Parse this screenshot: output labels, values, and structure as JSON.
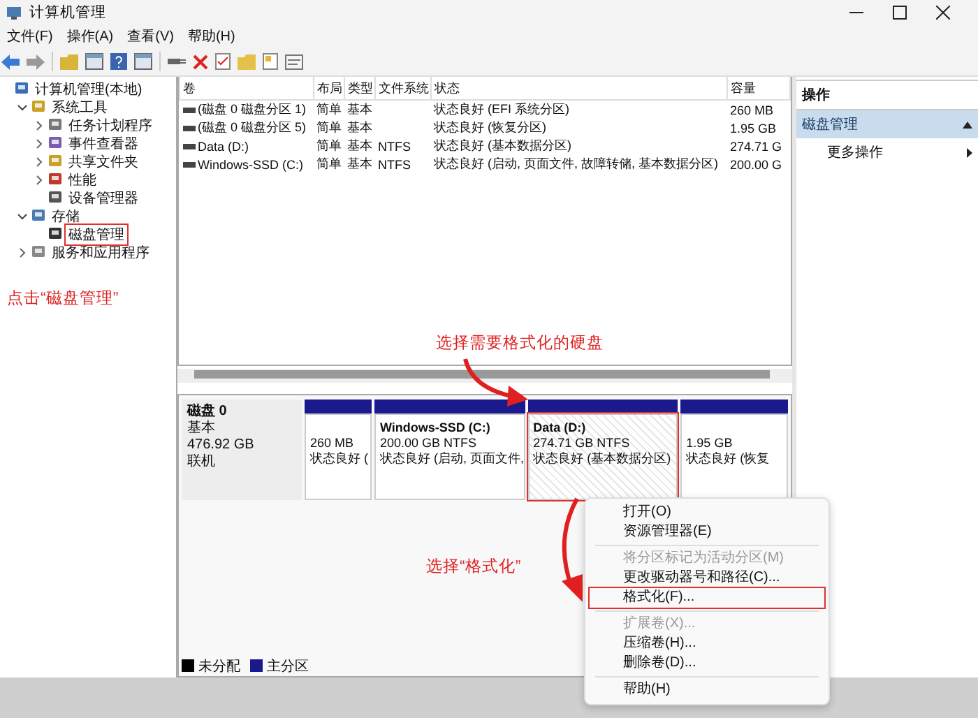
{
  "window": {
    "title": "计算机管理"
  },
  "menu_bar": [
    "文件(F)",
    "操作(A)",
    "查看(V)",
    "帮助(H)"
  ],
  "tree": [
    {
      "label": "计算机管理(本地)",
      "children": [
        {
          "label": "系统工具",
          "expanded": true,
          "children": [
            {
              "label": "任务计划程序",
              "expanded": false
            },
            {
              "label": "事件查看器",
              "expanded": false
            },
            {
              "label": "共享文件夹",
              "expanded": false
            },
            {
              "label": "性能",
              "expanded": false
            },
            {
              "label": "设备管理器"
            }
          ]
        },
        {
          "label": "存储",
          "expanded": true,
          "children": [
            {
              "label": "磁盘管理",
              "callout": true
            }
          ]
        },
        {
          "label": "服务和应用程序",
          "expanded": false
        }
      ]
    }
  ],
  "volume_table": {
    "columns": [
      "卷",
      "布局",
      "类型",
      "文件系统",
      "状态",
      "容量"
    ],
    "rows": [
      {
        "volume": "(磁盘 0 磁盘分区 1)",
        "layout": "简单",
        "type": "基本",
        "status": "状态良好 (EFI 系统分区)",
        "capacity": "260 MB"
      },
      {
        "volume": "(磁盘 0 磁盘分区 5)",
        "layout": "简单",
        "type": "基本",
        "status": "状态良好 (恢复分区)",
        "capacity": "1.95 GB"
      },
      {
        "volume": "Data (D:)",
        "layout": "简单",
        "type": "基本",
        "filesystem": "NTFS",
        "status": "状态良好 (基本数据分区)",
        "capacity": "274.71 G"
      },
      {
        "volume": "Windows-SSD (C:)",
        "layout": "简单",
        "type": "基本",
        "filesystem": "NTFS",
        "status": "状态良好 (启动, 页面文件, 故障转储, 基本数据分区)",
        "capacity": "200.00 G"
      }
    ]
  },
  "disk": {
    "name": "磁盘 0",
    "type": "基本",
    "size": "476.92 GB",
    "status": "联机",
    "partitions": [
      {
        "size": "260 MB",
        "status": "状态良好 (",
        "selected": false
      },
      {
        "title": "Windows-SSD  (C:)",
        "size": "200.00 GB NTFS",
        "status": "状态良好 (启动, 页面文件,",
        "selected": false
      },
      {
        "title": "Data  (D:)",
        "size": "274.71 GB NTFS",
        "status": "状态良好 (基本数据分区)",
        "selected": true,
        "callout": true
      },
      {
        "size": "1.95 GB",
        "status": "状态良好 (恢复",
        "selected": false
      }
    ]
  },
  "legend": [
    {
      "label": "未分配",
      "color": "#000000"
    },
    {
      "label": "主分区",
      "color": "#1a1a8c"
    }
  ],
  "actions": {
    "header": "操作",
    "section": {
      "title": "磁盘管理",
      "expanded": true
    },
    "items": [
      "更多操作"
    ]
  },
  "context_menu": [
    {
      "kind": "item",
      "label": "打开(O)",
      "disabled": false
    },
    {
      "kind": "item",
      "label": "资源管理器(E)",
      "disabled": false
    },
    {
      "kind": "separator"
    },
    {
      "kind": "item",
      "label": "将分区标记为活动分区(M)",
      "disabled": true
    },
    {
      "kind": "item",
      "label": "更改驱动器号和路径(C)...",
      "disabled": false
    },
    {
      "kind": "item",
      "label": "格式化(F)...",
      "disabled": false,
      "callout": true
    },
    {
      "kind": "separator"
    },
    {
      "kind": "item",
      "label": "扩展卷(X)...",
      "disabled": true
    },
    {
      "kind": "item",
      "label": "压缩卷(H)...",
      "disabled": false
    },
    {
      "kind": "item",
      "label": "删除卷(D)...",
      "disabled": false
    },
    {
      "kind": "separator"
    },
    {
      "kind": "item",
      "label": "帮助(H)",
      "disabled": false
    }
  ],
  "annotations": [
    "点击“磁盘管理”",
    "选择需要格式化的硬盘",
    "选择“格式化”"
  ]
}
